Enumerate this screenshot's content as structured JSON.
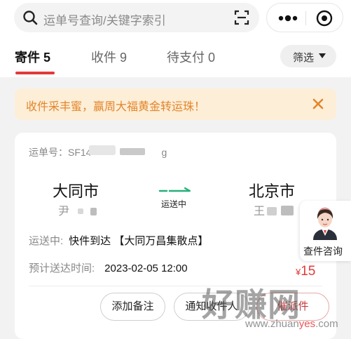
{
  "search": {
    "placeholder": "运单号查询/关键字索引"
  },
  "icons": {
    "search": "search-icon",
    "scan": "scan-icon",
    "more": "more-icon",
    "close": "close-circle-icon"
  },
  "tabs": [
    {
      "label": "寄件",
      "count": "5",
      "active": true
    },
    {
      "label": "收件",
      "count": "9",
      "active": false
    },
    {
      "label": "待支付",
      "count": "0",
      "active": false
    }
  ],
  "filter": {
    "label": "筛选"
  },
  "banner": {
    "text": "收件采丰蜜，赢周大福黄金转运珠！"
  },
  "card": {
    "waybill_label": "运单号：SF14",
    "waybill_tail": "g",
    "from_city": "大同市",
    "from_person": "尹",
    "to_city": "北京市",
    "to_person": "王",
    "route_status": "运送中",
    "detail_key": "运送中:",
    "detail_value": "快件到达 【大同万昌集散点】",
    "eta_key": "预计送达时间:",
    "eta_value": "2023-02-05 12:00",
    "price_symbol": "¥",
    "price": "15",
    "buttons": {
      "note": "添加备注",
      "notify": "通知收件人",
      "more": "催派件"
    }
  },
  "float": {
    "label": "查件咨询"
  },
  "watermark": {
    "main": "好赚网",
    "sub_pre": "www.zhuan",
    "sub_yes": "yes",
    "sub_post": ".com"
  },
  "colors": {
    "accent": "#e23a3a",
    "banner_bg": "#fdeed8",
    "banner_text": "#e2862a",
    "route": "#27b07a"
  }
}
